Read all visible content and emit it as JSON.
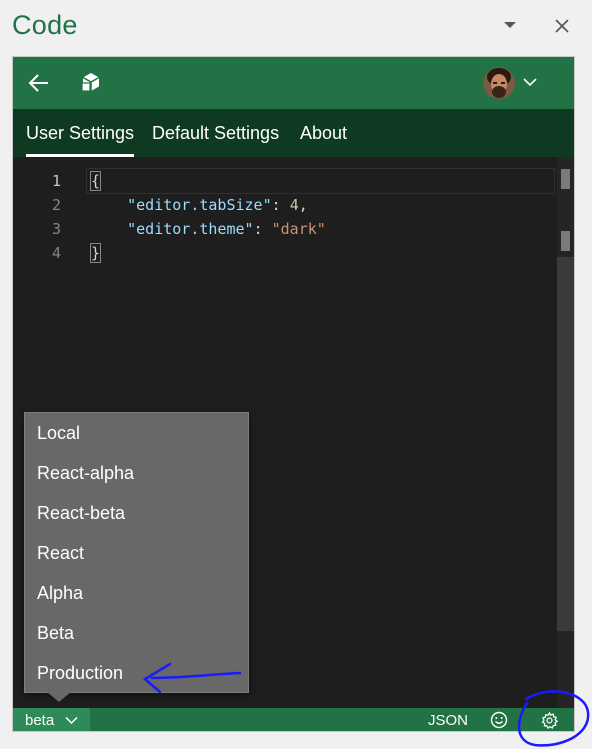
{
  "pane": {
    "title": "Code"
  },
  "tabs": [
    {
      "label": "User Settings",
      "active": true
    },
    {
      "label": "Default Settings",
      "active": false
    },
    {
      "label": "About",
      "active": false
    }
  ],
  "editor": {
    "line_numbers": [
      "1",
      "2",
      "3",
      "4"
    ],
    "lines": {
      "open_brace": "{",
      "line2_key": "\"editor.tabSize\"",
      "line2_sep": ": ",
      "line2_value": "4",
      "line2_end": ",",
      "line3_key": "\"editor.theme\"",
      "line3_sep": ": ",
      "line3_value": "\"dark\"",
      "close_brace": "}"
    }
  },
  "environment_menu": {
    "items": [
      "Local",
      "React-alpha",
      "React-beta",
      "React",
      "Alpha",
      "Beta",
      "Production"
    ]
  },
  "statusbar": {
    "environment": "beta",
    "language": "JSON"
  },
  "icons": {
    "back": "arrow-left-icon",
    "logo": "cube-logo-icon",
    "feedback": "smiley-icon",
    "settings": "gear-icon"
  },
  "colors": {
    "brand_green": "#217346",
    "tab_bar": "#0e3a22",
    "editor_bg": "#1e1e1e",
    "menu_bg": "#686868",
    "annotation": "#1a1aff"
  }
}
